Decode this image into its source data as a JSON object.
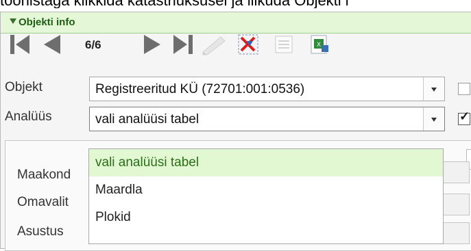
{
  "caption": "toonistaga klikkida katastriüksusel ja liikuda Objekti i",
  "panel": {
    "title": "Objekti info"
  },
  "toolbar": {
    "page_indicator": "6/6"
  },
  "form": {
    "objekt_label": "Objekt",
    "objekt_value": "Registreeritud KÜ (72701:001:0536)",
    "objekt_checked": false,
    "analuus_label": "Analüüs",
    "analuus_value": "vali analüüsi tabel",
    "analuus_checked": true
  },
  "details": {
    "fields": [
      "Maakond",
      "Omavalit",
      "Asustus"
    ]
  },
  "dropdown": {
    "options": [
      "vali analüüsi tabel",
      "Maardla",
      "Plokid"
    ],
    "selected_index": 0
  },
  "colors": {
    "header_bg": "#e4f7d6",
    "selected_bg": "#e2f8d3",
    "accent_green": "#2a6e16"
  }
}
